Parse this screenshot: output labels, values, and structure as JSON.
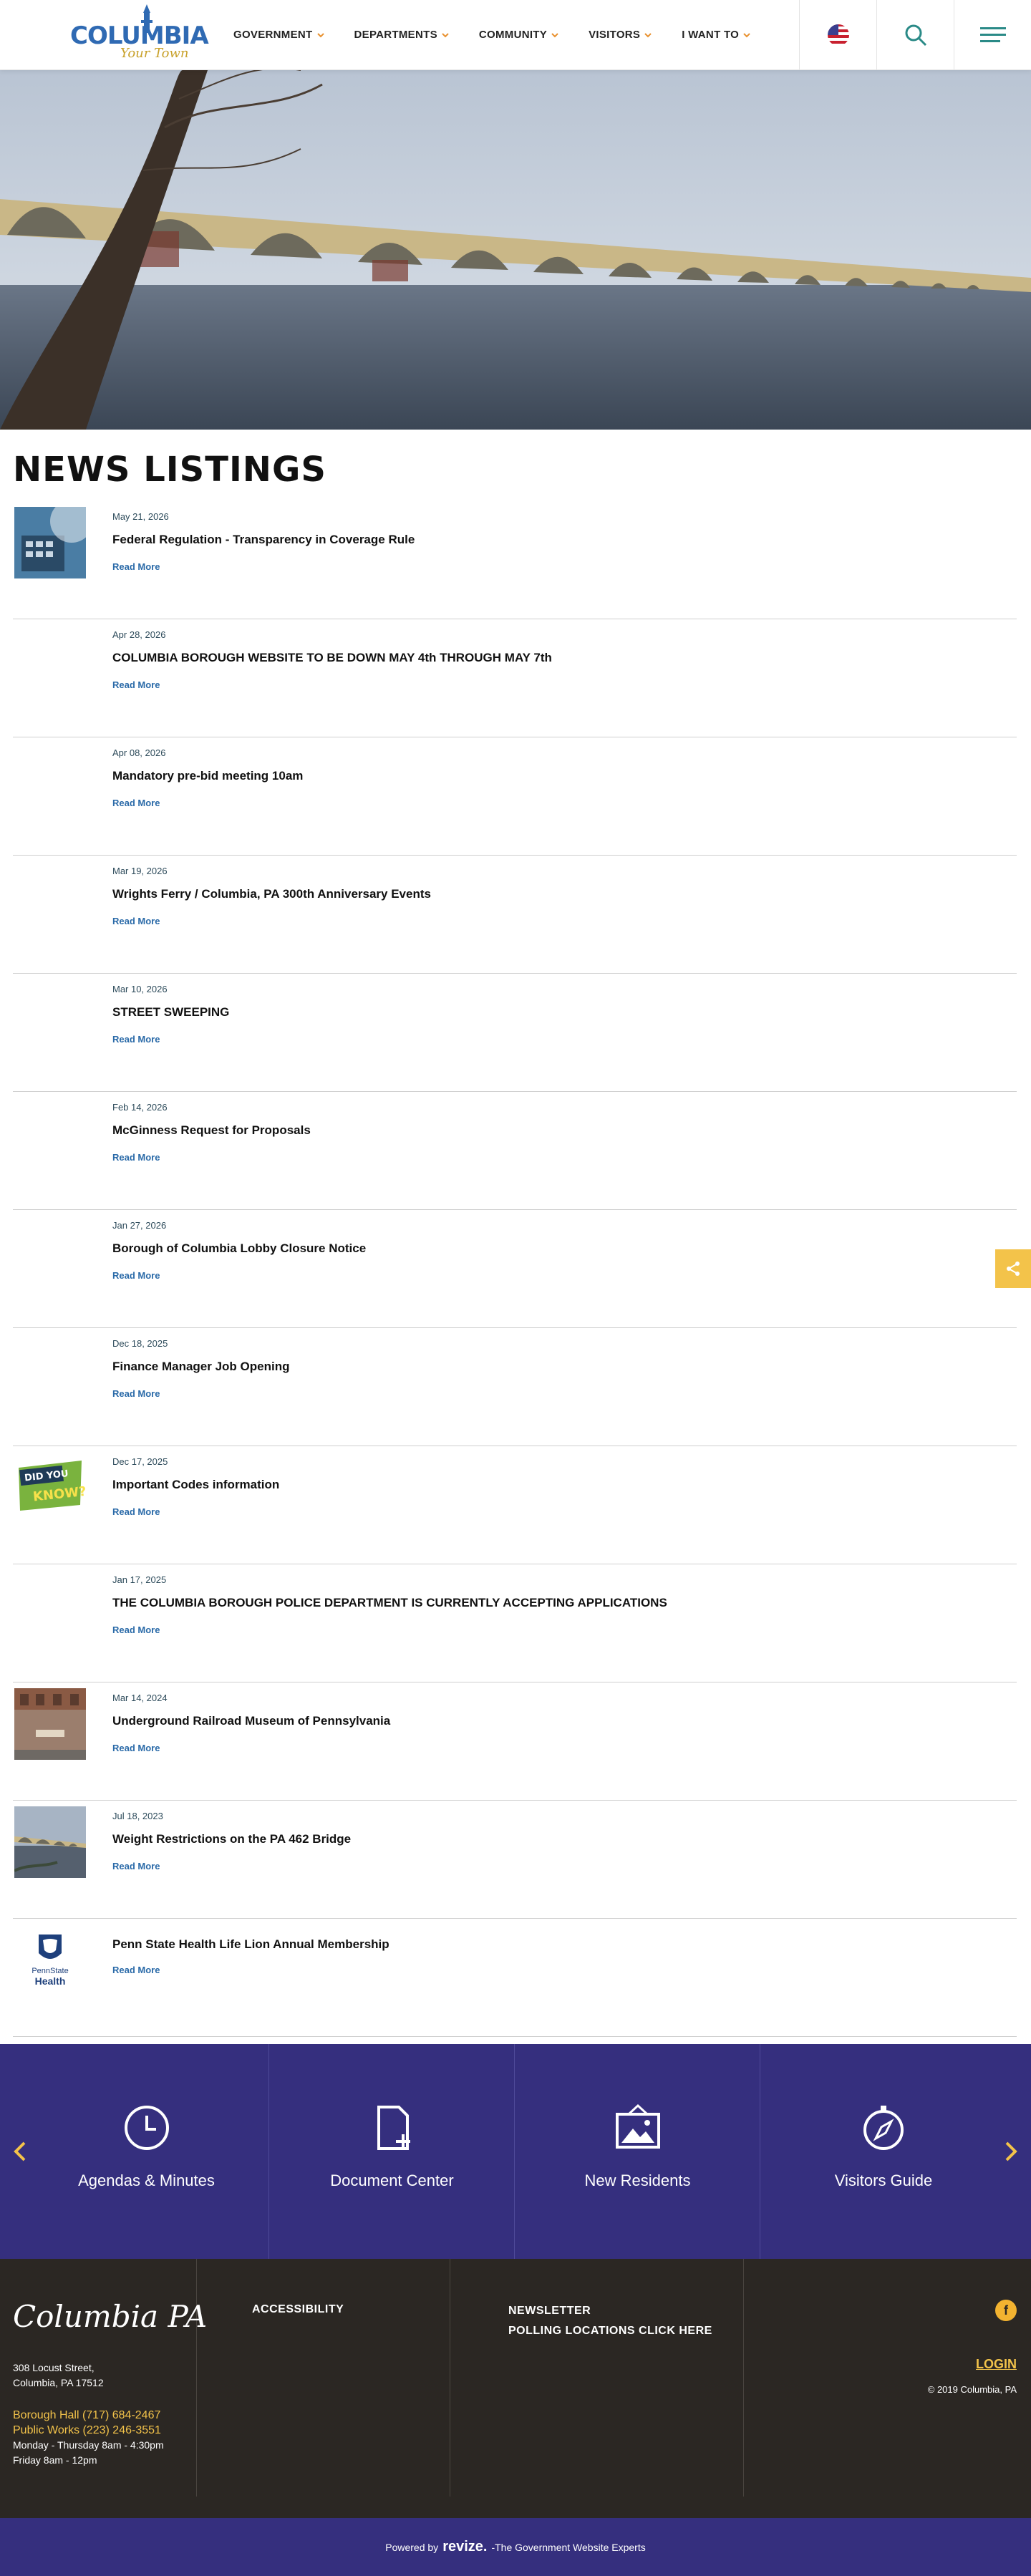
{
  "header": {
    "logo_text": "COLUMBIA",
    "logo_tagline": "Your Town",
    "nav": [
      {
        "label": "GOVERNMENT"
      },
      {
        "label": "DEPARTMENTS"
      },
      {
        "label": "COMMUNITY"
      },
      {
        "label": "VISITORS"
      },
      {
        "label": "I WANT TO"
      }
    ],
    "accent_color": "#e8912f"
  },
  "page": {
    "title": "NEWS LISTINGS"
  },
  "news": [
    {
      "date": "May 21, 2026",
      "title": "Federal Regulation - Transparency in Coverage Rule",
      "link": "Read More",
      "thumb": "calculator"
    },
    {
      "date": "Apr 28, 2026",
      "title": "COLUMBIA BOROUGH WEBSITE TO BE DOWN MAY 4th THROUGH MAY 7th",
      "link": "Read More",
      "thumb": ""
    },
    {
      "date": "Apr 08, 2026",
      "title": "Mandatory pre-bid meeting 10am",
      "link": "Read More",
      "thumb": ""
    },
    {
      "date": "Mar 19, 2026",
      "title": "Wrights Ferry / Columbia, PA 300th Anniversary Events",
      "link": "Read More",
      "thumb": ""
    },
    {
      "date": "Mar 10, 2026",
      "title": "STREET SWEEPING",
      "link": "Read More",
      "thumb": ""
    },
    {
      "date": "Feb 14, 2026",
      "title": "McGinness Request for Proposals",
      "link": "Read More",
      "thumb": ""
    },
    {
      "date": "Jan 27, 2026",
      "title": "Borough of Columbia Lobby Closure Notice",
      "link": "Read More",
      "thumb": ""
    },
    {
      "date": "Dec 18, 2025",
      "title": "Finance Manager Job Opening",
      "link": "Read More",
      "thumb": ""
    },
    {
      "date": "Dec 17, 2025",
      "title": "Important Codes information",
      "link": "Read More",
      "thumb": "did-you-know"
    },
    {
      "date": "Jan 17, 2025",
      "title": "THE COLUMBIA BOROUGH POLICE DEPARTMENT IS CURRENTLY ACCEPTING APPLICATIONS",
      "link": "Read More",
      "thumb": ""
    },
    {
      "date": "Mar 14, 2024",
      "title": "Underground Railroad Museum of Pennsylvania",
      "link": "Read More",
      "thumb": "building"
    },
    {
      "date": "Jul 18, 2023",
      "title": "Weight Restrictions on the PA 462 Bridge",
      "link": "Read More",
      "thumb": "bridge"
    },
    {
      "date": "",
      "title": "Penn State Health Life Lion Annual Membership",
      "link": "Read More",
      "thumb": "penn-state"
    }
  ],
  "thumb_text": {
    "did_you_know": [
      "DID YOU",
      "KNOW?"
    ],
    "penn_state": [
      "PennState",
      "Health"
    ]
  },
  "quick_links": [
    {
      "label": "Agendas & Minutes",
      "icon": "clock-icon"
    },
    {
      "label": "Document Center",
      "icon": "document-add-icon"
    },
    {
      "label": "New Residents",
      "icon": "picture-frame-icon"
    },
    {
      "label": "Visitors Guide",
      "icon": "compass-icon"
    }
  ],
  "footer": {
    "brand": "Columbia PA",
    "address_line1": "308 Locust Street,",
    "address_line2": "Columbia, PA 17512",
    "phone_borough": "Borough Hall (717) 684-2467",
    "phone_public_works": "Public Works (223) 246-3551",
    "hours_weekday": "Monday - Thursday 8am - 4:30pm",
    "hours_friday": "Friday 8am - 12pm",
    "link_accessibility": "ACCESSIBILITY",
    "link_newsletter": "NEWSLETTER",
    "link_polling": "POLLING LOCATIONS CLICK HERE",
    "social": "f",
    "login": "LOGIN",
    "copyright": "© 2019 Columbia, PA"
  },
  "powered": {
    "prefix": "Powered by",
    "brand": "revize.",
    "suffix": "-The Government Website Experts"
  }
}
